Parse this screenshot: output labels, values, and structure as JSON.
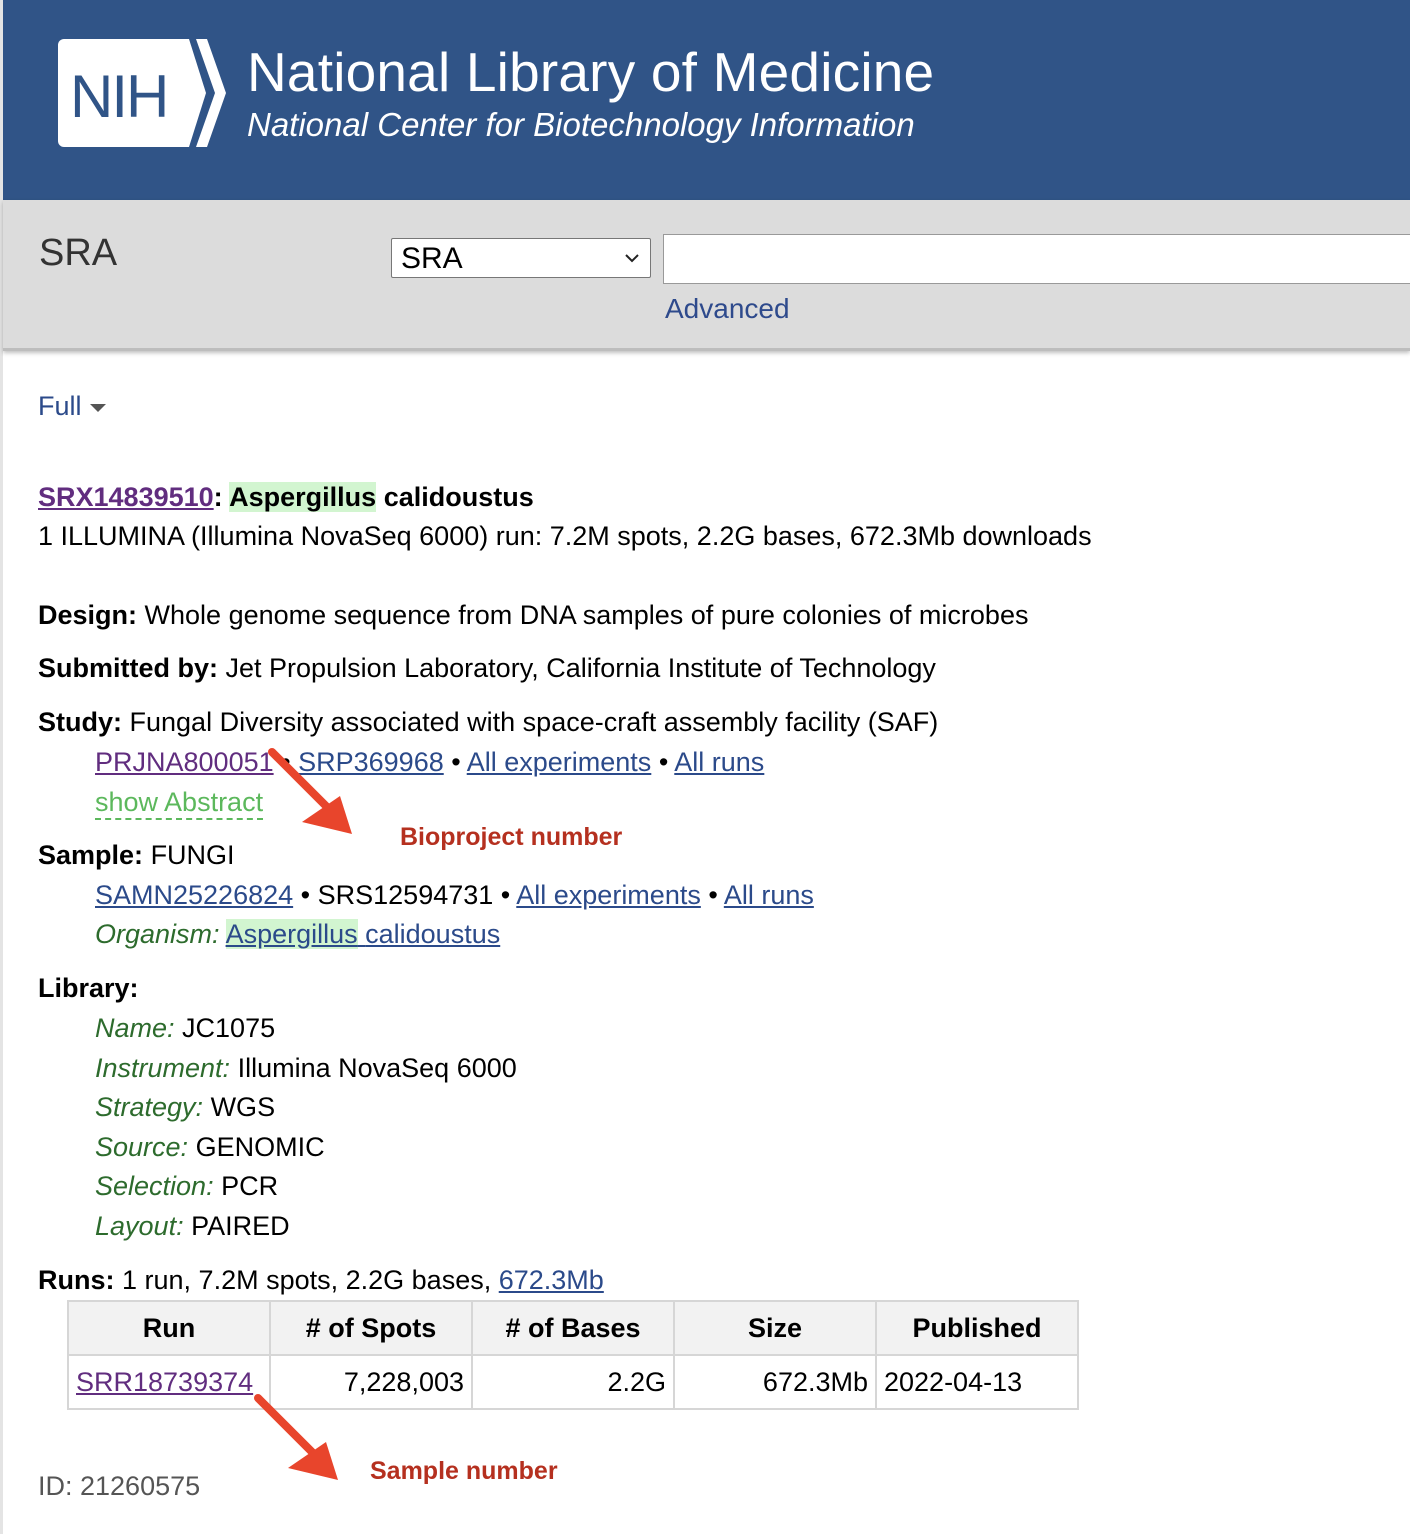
{
  "header": {
    "logo_text": "NIH",
    "title": "National Library of Medicine",
    "subtitle": "National Center for Biotechnology Information"
  },
  "search": {
    "section_label": "SRA",
    "database_selected": "SRA",
    "query_value": "",
    "advanced_label": "Advanced"
  },
  "display": {
    "format_label": "Full"
  },
  "record": {
    "accession": "SRX14839510",
    "colon": ":",
    "title_genus": "Aspergillus",
    "title_species": "calidoustus",
    "summary": "1 ILLUMINA (Illumina NovaSeq 6000) run: 7.2M spots, 2.2G bases, 672.3Mb downloads",
    "design_label": "Design:",
    "design_value": "Whole genome sequence from DNA samples of pure colonies of microbes",
    "submitted_label": "Submitted by:",
    "submitted_value": "Jet Propulsion Laboratory, California Institute of Technology",
    "study_label": "Study:",
    "study_value": "Fungal Diversity associated with space-craft assembly facility (SAF)",
    "study_links": {
      "bioproject": "PRJNA800051",
      "srp": "SRP369968",
      "all_experiments": "All experiments",
      "all_runs": "All runs",
      "separator": "•"
    },
    "show_abstract": "show Abstract",
    "sample_label": "Sample:",
    "sample_value": "FUNGI",
    "sample_links": {
      "biosample": "SAMN25226824",
      "srs": "SRS12594731",
      "all_experiments": "All experiments",
      "all_runs": "All runs"
    },
    "organism_label": "Organism:",
    "organism_genus": "Aspergillus",
    "organism_species": "calidoustus",
    "library_label": "Library:",
    "library": [
      {
        "label": "Name:",
        "value": "JC1075"
      },
      {
        "label": "Instrument:",
        "value": "Illumina NovaSeq 6000"
      },
      {
        "label": "Strategy:",
        "value": "WGS"
      },
      {
        "label": "Source:",
        "value": "GENOMIC"
      },
      {
        "label": "Selection:",
        "value": "PCR"
      },
      {
        "label": "Layout:",
        "value": "PAIRED"
      }
    ],
    "runs_label": "Runs:",
    "runs_summary": "1 run, 7.2M spots, 2.2G bases,",
    "runs_size_link": "672.3Mb",
    "runs_table": {
      "headers": [
        "Run",
        "# of Spots",
        "# of Bases",
        "Size",
        "Published"
      ],
      "rows": [
        [
          "SRR18739374",
          "7,228,003",
          "2.2G",
          "672.3Mb",
          "2022-04-13"
        ]
      ]
    },
    "id_text": "ID: 21260575"
  },
  "annotations": {
    "bioproject_note": "Bioproject number",
    "sample_note": "Sample number",
    "color": "#e8452c"
  }
}
